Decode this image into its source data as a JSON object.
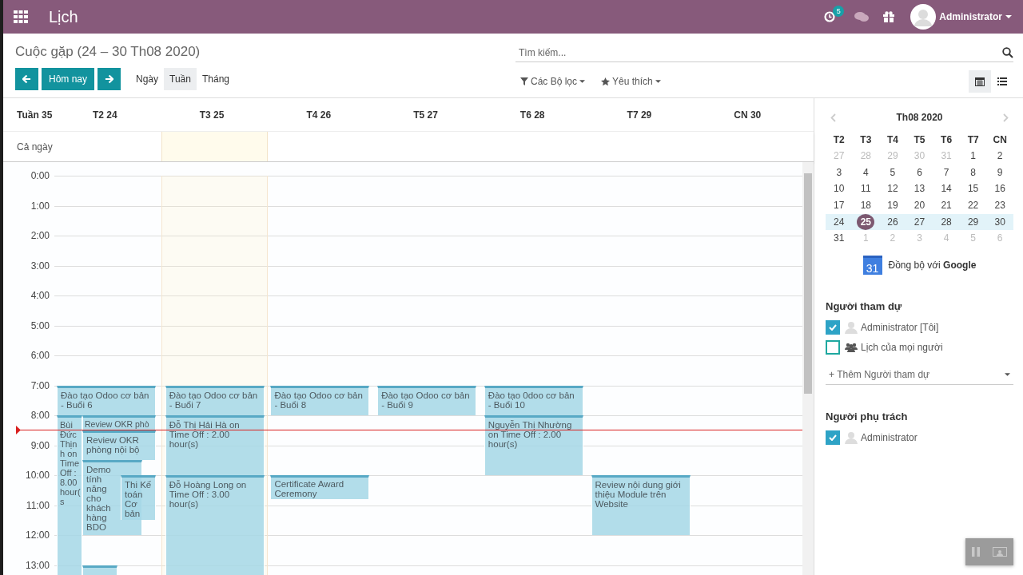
{
  "navbar": {
    "app_title": "Lịch",
    "activity_count": "5",
    "user_name": "Administrator"
  },
  "control_panel": {
    "title": "Cuộc gặp (24 – 30 Th08 2020)",
    "today_button": "Hôm nay",
    "view_scales": [
      {
        "label": "Ngày",
        "selected": false
      },
      {
        "label": "Tuần",
        "selected": true
      },
      {
        "label": "Tháng",
        "selected": false
      }
    ],
    "search": {
      "placeholder": "Tìm kiếm..."
    },
    "filters": [
      {
        "kind": "filter",
        "label": "Các Bộ lọc"
      },
      {
        "kind": "favorite",
        "label": "Yêu thích"
      }
    ],
    "view_switcher": [
      {
        "kind": "calendar",
        "selected": true
      },
      {
        "kind": "list",
        "selected": false
      }
    ]
  },
  "calendar": {
    "week_label": "Tuần 35",
    "all_day_label": "Cả ngày",
    "hours": [
      "0:00",
      "1:00",
      "2:00",
      "3:00",
      "4:00",
      "5:00",
      "6:00",
      "7:00",
      "8:00",
      "9:00",
      "10:00",
      "11:00",
      "12:00",
      "13:00"
    ],
    "days": [
      {
        "label": "T2 24",
        "today": false,
        "events": [
          {
            "kind": "event",
            "title": "Đào tạo Odoo cơ bản - Buổi 6"
          },
          {
            "kind": "event",
            "title": "Bùi Đức Thịnh on Time Off : 8.00 hour(s"
          },
          {
            "kind": "event",
            "title": "Review OKR phò"
          },
          {
            "kind": "event",
            "title": "Review OKR phòng nội bộ"
          },
          {
            "kind": "event",
            "title": "Demo tính năng cho khách hàng BDO"
          },
          {
            "kind": "event",
            "title": "Thi Kế toán Cơ bản"
          },
          {
            "kind": "event"
          }
        ]
      },
      {
        "label": "T3 25",
        "today": true,
        "events": [
          {
            "kind": "event",
            "title": "Đào tạo Odoo cơ bản - Buổi 7"
          },
          {
            "kind": "event",
            "title": "Đỗ Thị Hải Hà on Time Off : 2.00 hour(s)"
          },
          {
            "kind": "event",
            "title": "Đỗ Hoàng Long on Time Off : 3.00 hour(s)"
          }
        ]
      },
      {
        "label": "T4 26",
        "today": false,
        "events": [
          {
            "kind": "event",
            "title": "Đào tạo Odoo cơ bản - Buổi 8"
          },
          {
            "kind": "event",
            "title": "Certificate Award Ceremony"
          }
        ]
      },
      {
        "label": "T5 27",
        "today": false,
        "events": [
          {
            "kind": "event",
            "title": "Đào tạo Odoo cơ bản - Buổi 9"
          }
        ]
      },
      {
        "label": "T6 28",
        "today": false,
        "events": [
          {
            "kind": "event",
            "title": "Đào tạo 0doo cơ bản - Buổi 10"
          },
          {
            "kind": "event",
            "title": "Nguyễn Thị Nhường on Time Off : 2.00 hour(s)"
          }
        ]
      },
      {
        "label": "T7 29",
        "today": false,
        "events": [
          {
            "kind": "event",
            "title": "Review nội dung giới thiệu Module trên Website"
          }
        ]
      },
      {
        "label": "CN 30",
        "today": false
      }
    ]
  },
  "sidebar": {
    "mini_calendar": {
      "month": "Th08 2020",
      "weekdays": [
        "T2",
        "T3",
        "T4",
        "T5",
        "T6",
        "T7",
        "CN"
      ],
      "weeks": [
        {
          "current": false,
          "days": [
            {
              "day": "27",
              "other_month": true,
              "selected": false
            },
            {
              "day": "28",
              "other_month": true,
              "selected": false
            },
            {
              "day": "29",
              "other_month": true,
              "selected": false
            },
            {
              "day": "30",
              "other_month": true,
              "selected": false
            },
            {
              "day": "31",
              "other_month": true,
              "selected": false
            },
            {
              "day": "1",
              "other_month": false,
              "selected": false
            },
            {
              "day": "2",
              "other_month": false,
              "selected": false
            }
          ]
        },
        {
          "current": false,
          "days": [
            {
              "day": "3",
              "other_month": false,
              "selected": false
            },
            {
              "day": "4",
              "other_month": false,
              "selected": false
            },
            {
              "day": "5",
              "other_month": false,
              "selected": false
            },
            {
              "day": "6",
              "other_month": false,
              "selected": false
            },
            {
              "day": "7",
              "other_month": false,
              "selected": false
            },
            {
              "day": "8",
              "other_month": false,
              "selected": false
            },
            {
              "day": "9",
              "other_month": false,
              "selected": false
            }
          ]
        },
        {
          "current": false,
          "days": [
            {
              "day": "10",
              "other_month": false,
              "selected": false
            },
            {
              "day": "11",
              "other_month": false,
              "selected": false
            },
            {
              "day": "12",
              "other_month": false,
              "selected": false
            },
            {
              "day": "13",
              "other_month": false,
              "selected": false
            },
            {
              "day": "14",
              "other_month": false,
              "selected": false
            },
            {
              "day": "15",
              "other_month": false,
              "selected": false
            },
            {
              "day": "16",
              "other_month": false,
              "selected": false
            }
          ]
        },
        {
          "current": false,
          "days": [
            {
              "day": "17",
              "other_month": false,
              "selected": false
            },
            {
              "day": "18",
              "other_month": false,
              "selected": false
            },
            {
              "day": "19",
              "other_month": false,
              "selected": false
            },
            {
              "day": "20",
              "other_month": false,
              "selected": false
            },
            {
              "day": "21",
              "other_month": false,
              "selected": false
            },
            {
              "day": "22",
              "other_month": false,
              "selected": false
            },
            {
              "day": "23",
              "other_month": false,
              "selected": false
            }
          ]
        },
        {
          "current": true,
          "days": [
            {
              "day": "24",
              "other_month": false,
              "selected": false
            },
            {
              "day": "25",
              "other_month": false,
              "selected": true
            },
            {
              "day": "26",
              "other_month": false,
              "selected": false
            },
            {
              "day": "27",
              "other_month": false,
              "selected": false
            },
            {
              "day": "28",
              "other_month": false,
              "selected": false
            },
            {
              "day": "29",
              "other_month": false,
              "selected": false
            },
            {
              "day": "30",
              "other_month": false,
              "selected": false
            }
          ]
        },
        {
          "current": false,
          "days": [
            {
              "day": "31",
              "other_month": false,
              "selected": false
            },
            {
              "day": "1",
              "other_month": true,
              "selected": false
            },
            {
              "day": "2",
              "other_month": true,
              "selected": false
            },
            {
              "day": "3",
              "other_month": true,
              "selected": false
            },
            {
              "day": "4",
              "other_month": true,
              "selected": false
            },
            {
              "day": "5",
              "other_month": true,
              "selected": false
            },
            {
              "day": "6",
              "other_month": true,
              "selected": false
            }
          ]
        }
      ]
    },
    "google_sync": {
      "icon_text": "31",
      "label": "Đồng bộ với **Google**"
    },
    "attendees": {
      "title": "Người tham dự",
      "items": [
        {
          "kind": "user",
          "label": "Administrator [Tôi]",
          "checked": true
        },
        {
          "kind": "everyone",
          "label": "Lịch của mọi người",
          "checked": false
        }
      ],
      "add_placeholder": "+ Thêm Người tham dự"
    },
    "responsible": {
      "title": "Người phụ trách",
      "items": [
        {
          "kind": "user",
          "label": "Administrator",
          "checked": true
        }
      ]
    }
  }
}
